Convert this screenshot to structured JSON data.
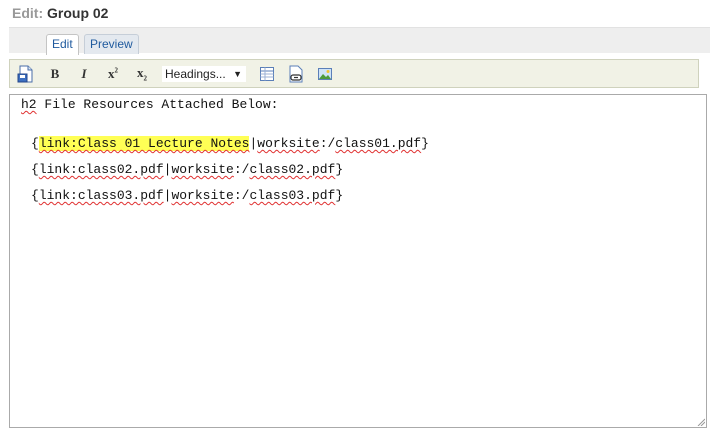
{
  "header": {
    "prefix": "Edit:",
    "title": "Group 02"
  },
  "tabs": [
    {
      "label": "Edit"
    },
    {
      "label": "Preview"
    }
  ],
  "toolbar": {
    "bold": "B",
    "italic": "I",
    "superscript": "x",
    "superscript_mark": "2",
    "subscript": "x",
    "subscript_mark": "2",
    "headings": "Headings...",
    "headings_arrow": "▼"
  },
  "editor": {
    "line1": {
      "tag": "h2",
      "text": " File Resources Attached Below:"
    },
    "links": [
      {
        "link": "link:Class 01 Lecture Notes",
        "site": "worksite",
        "file": "class01.pdf"
      },
      {
        "link": "link:class02.pdf",
        "site": "worksite",
        "file": "class02.pdf"
      },
      {
        "link": "link:class03.pdf",
        "site": "worksite",
        "file": "class03.pdf"
      }
    ],
    "highlight_color": "#ffff55"
  }
}
